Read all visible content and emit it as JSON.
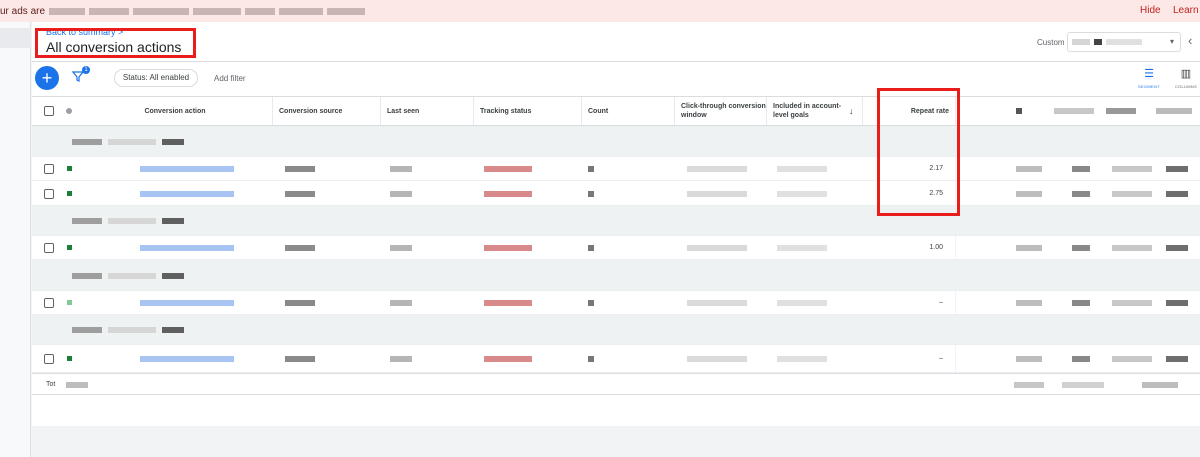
{
  "banner": {
    "message": "ur ads are",
    "hide_label": "Hide",
    "learn_label": "Learn r"
  },
  "header": {
    "back_link": "Back to summary >",
    "title": "All conversion actions",
    "custom_label": "Custom",
    "range_caret": "▾",
    "collapse_icon": "‹"
  },
  "toolbar": {
    "add_icon": "+",
    "filter_badge": "1",
    "status_chip": "Status: All enabled",
    "add_filter": "Add filter",
    "segment_label": "SEGMENT",
    "columns_label": "COLUMNS"
  },
  "table": {
    "columns": [
      "Conversion action",
      "Conversion source",
      "Last seen",
      "Tracking status",
      "Count",
      "Click-through conversion window",
      "Included in account-level goals",
      "Repeat rate"
    ],
    "sort_icon": "↓",
    "rows": [
      {
        "kind": "group"
      },
      {
        "kind": "data",
        "repeat_rate": "2.17",
        "status": "dark"
      },
      {
        "kind": "data",
        "repeat_rate": "2.75",
        "status": "dark"
      },
      {
        "kind": "group"
      },
      {
        "kind": "data",
        "repeat_rate": "1.00",
        "status": "dark"
      },
      {
        "kind": "group"
      },
      {
        "kind": "data",
        "repeat_rate": "–",
        "status": "light"
      },
      {
        "kind": "group"
      },
      {
        "kind": "data",
        "repeat_rate": "–",
        "status": "dark"
      }
    ],
    "total_label": "Tot"
  },
  "colors": {
    "accent": "#1a73e8",
    "highlight_box": "#ea1d1d",
    "status_enabled": "#188038",
    "banner_bg": "#fce8e6"
  }
}
